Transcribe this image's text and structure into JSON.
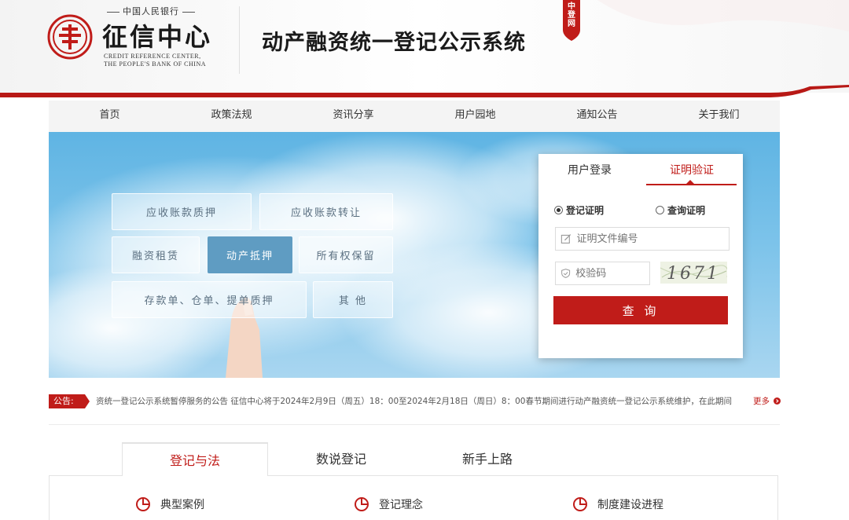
{
  "header": {
    "bank_top_text": "中国人民银行",
    "logo_name": "征信中心",
    "logo_en_line1": "CREDIT REFERENCE CENTER,",
    "logo_en_line2": "THE PEOPLE'S BANK OF CHINA",
    "system_title": "动产融资统一登记公示系统",
    "badge_text_1": "中",
    "badge_text_2": "登",
    "badge_text_3": "网",
    "brand_red": "#c01c19"
  },
  "nav": {
    "items": [
      "首页",
      "政策法规",
      "资讯分享",
      "用户园地",
      "通知公告",
      "关于我们"
    ]
  },
  "banner": {
    "tiles": [
      "应收账款质押",
      "应收账款转让",
      "融资租赁",
      "动产抵押",
      "所有权保留",
      "存款单、仓单、提单质押",
      "其 他"
    ],
    "active_tile": "动产抵押"
  },
  "login_panel": {
    "tabs": [
      "用户登录",
      "证明验证"
    ],
    "active_tab": "证明验证",
    "radio_options": [
      "登记证明",
      "查询证明"
    ],
    "selected_radio": "登记证明",
    "cert_placeholder": "证明文件编号",
    "captcha_placeholder": "校验码",
    "captcha_code": "1671",
    "submit_label": "查 询"
  },
  "notice": {
    "tag": "公告:",
    "text": "资统一登记公示系统暂停服务的公告 征信中心将于2024年2月9日（周五）18：00至2024年2月18日（周日）8：00春节期间进行动产融资统一登记公示系统维护，在此期间",
    "more_label": "更多"
  },
  "bottom_tabs": {
    "tabs": [
      "登记与法",
      "数说登记",
      "新手上路"
    ],
    "active_tab": "登记与法",
    "items": [
      "典型案例",
      "登记理念",
      "制度建设进程"
    ]
  }
}
